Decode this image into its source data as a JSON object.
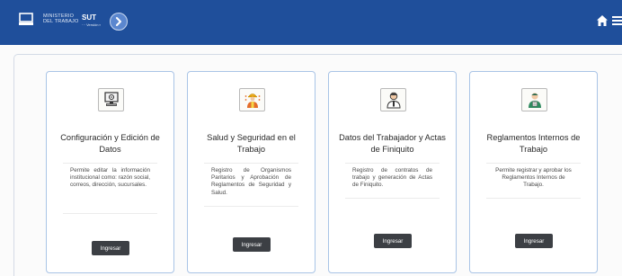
{
  "header": {
    "ministry_line1": "MINISTERIO",
    "ministry_line2": "DEL TRABAJO",
    "sut_label": "SUT",
    "sut_sub": "··· Versión ▪"
  },
  "cards": [
    {
      "title": "Configuración y Edición de Datos",
      "description": "Permite editar la información institucional como: razón social, correos, dirección, sucursales.",
      "button": "Ingresar"
    },
    {
      "title": "Salud y Seguridad en el Trabajo",
      "description": "Registro de Organismos Paritarios y Aprobación de Reglamentos de Seguridad y Salud.",
      "button": "Ingresar"
    },
    {
      "title": "Datos del Trabajador y Actas de Finiquito",
      "description": "Registro de contratos de trabajo y generación de Actas de Finiquito.",
      "button": "Ingresar"
    },
    {
      "title": "Reglamentos Internos de Trabajo",
      "description": "Permite registrar y aprobar los Reglamentos Internos de Trabajo.",
      "button": "Ingresar"
    }
  ],
  "icons": {
    "logo": "building-monitor-icon",
    "nav_toggle": "chevron-right-icon",
    "home": "home-icon",
    "menu": "hamburger-menu-icon",
    "card1": "computer-settings-icon",
    "card2": "safety-worker-icon",
    "card3": "worker-profile-icon",
    "card4": "worker-regulations-icon"
  },
  "colors": {
    "header_bg": "#1f4f9b",
    "card_border": "#a9c4e6",
    "button_bg": "#3c3f44"
  }
}
